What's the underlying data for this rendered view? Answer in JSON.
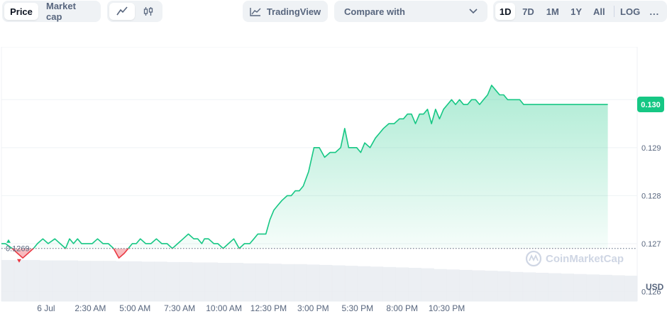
{
  "toolbar": {
    "price_tab": "Price",
    "market_cap_tab": "Market cap",
    "line_icon": "line-chart-icon",
    "candle_icon": "candlestick-icon",
    "tradingview_label": "TradingView",
    "compare_label": "Compare with",
    "ranges": [
      "1D",
      "7D",
      "1M",
      "1Y",
      "All",
      "LOG"
    ],
    "active_range": "1D",
    "more_label": "..."
  },
  "watermark": "CoinMarketCap",
  "colors": {
    "up": "#16c784",
    "down": "#ea3943",
    "baseline": "#58667e"
  },
  "chart_data": {
    "type": "area",
    "currency_label": "USD",
    "baseline_value": 0.1269,
    "baseline_label": "0.1269",
    "current_value_label": "0.130",
    "ylim": [
      0.1258,
      0.1311
    ],
    "yticks": [
      0.126,
      0.127,
      0.128,
      0.129,
      0.13
    ],
    "ytick_labels": [
      "0.126",
      "0.127",
      "0.128",
      "0.129",
      "0.130"
    ],
    "x_range": [
      0,
      23.8
    ],
    "xticks": [
      1.67,
      3.33,
      5.0,
      6.67,
      8.33,
      10.0,
      11.67,
      13.33,
      15.0,
      16.67,
      18.33,
      20.0
    ],
    "xtick_labels": [
      "6 Jul",
      "2:30 AM",
      "5:00 AM",
      "7:30 AM",
      "10:00 AM",
      "12:30 PM",
      "3:00 PM",
      "5:30 PM",
      "8:00 PM",
      "10:30 PM"
    ],
    "series": [
      {
        "x": [
          0,
          0.15,
          0.4,
          0.6,
          0.8,
          1.0,
          1.2,
          1.35,
          1.55,
          1.75,
          2.0,
          2.2,
          2.4,
          2.55,
          2.7,
          2.85,
          3.0,
          3.2,
          3.4,
          3.6,
          3.8,
          4.0,
          4.2,
          4.4,
          4.6,
          4.75,
          4.9,
          5.05,
          5.2,
          5.4,
          5.6,
          5.8,
          6.0,
          6.2,
          6.4,
          6.6,
          6.8,
          7.0,
          7.2,
          7.35,
          7.5,
          7.6,
          7.75,
          7.95,
          8.1,
          8.3,
          8.5,
          8.7,
          8.9,
          9.1,
          9.3,
          9.45,
          9.6,
          9.75,
          9.9,
          10.05,
          10.2,
          10.35,
          10.5,
          10.7,
          10.85,
          11.0,
          11.15,
          11.3,
          11.5,
          11.7,
          11.9,
          12.1,
          12.3,
          12.5,
          12.7,
          12.85,
          13.0,
          13.15,
          13.3,
          13.45,
          13.6,
          13.8,
          14.0,
          14.15,
          14.3,
          14.5,
          14.7,
          14.9,
          15.05,
          15.2,
          15.35,
          15.5,
          15.65,
          15.8,
          15.95,
          16.1,
          16.25,
          16.4,
          16.55,
          16.7,
          16.85,
          17.0,
          17.15,
          17.3,
          17.45,
          17.6,
          17.75,
          17.9,
          18.05,
          18.2,
          18.35,
          18.5,
          18.65,
          18.8,
          18.95,
          19.1,
          19.25,
          19.4,
          19.55,
          19.7,
          19.85,
          20.0,
          20.15,
          20.3,
          20.45,
          20.6,
          20.75,
          20.9,
          21.05,
          21.2,
          21.35,
          21.5,
          21.65,
          21.8,
          21.95,
          22.1,
          22.25,
          22.4,
          22.55,
          22.7
        ],
        "values": [
          0.127,
          0.127,
          0.1269,
          0.1268,
          0.1267,
          0.1268,
          0.1269,
          0.127,
          0.1271,
          0.127,
          0.1271,
          0.127,
          0.1269,
          0.1271,
          0.127,
          0.1271,
          0.127,
          0.127,
          0.127,
          0.1271,
          0.127,
          0.127,
          0.1269,
          0.1267,
          0.1268,
          0.1269,
          0.127,
          0.127,
          0.1271,
          0.127,
          0.127,
          0.1271,
          0.127,
          0.127,
          0.1269,
          0.127,
          0.1271,
          0.1272,
          0.1271,
          0.1271,
          0.127,
          0.1271,
          0.1271,
          0.127,
          0.127,
          0.1269,
          0.127,
          0.1271,
          0.1269,
          0.127,
          0.127,
          0.1271,
          0.1272,
          0.1272,
          0.1272,
          0.1275,
          0.1277,
          0.1278,
          0.1279,
          0.128,
          0.128,
          0.1281,
          0.1281,
          0.1282,
          0.1285,
          0.129,
          0.129,
          0.1288,
          0.1289,
          0.1289,
          0.129,
          0.1294,
          0.129,
          0.129,
          0.129,
          0.1289,
          0.1291,
          0.129,
          0.1292,
          0.1293,
          0.1294,
          0.1295,
          0.1295,
          0.1296,
          0.1296,
          0.1297,
          0.1297,
          0.1295,
          0.1297,
          0.1297,
          0.1298,
          0.1295,
          0.1298,
          0.1296,
          0.1298,
          0.1299,
          0.13,
          0.1299,
          0.13,
          0.1299,
          0.1299,
          0.13,
          0.13,
          0.1299,
          0.13,
          0.1301,
          0.1303,
          0.1302,
          0.1301,
          0.1301,
          0.13,
          0.13,
          0.13,
          0.13,
          0.1299,
          0.1299,
          0.1299,
          0.1299,
          0.1299,
          0.1299,
          0.1299,
          0.1299,
          0.1299,
          0.1299,
          0.1299,
          0.1299,
          0.1299,
          0.1299,
          0.1299,
          0.1299,
          0.1299,
          0.1299,
          0.1299,
          0.1299,
          0.1299,
          0.1299
        ]
      }
    ],
    "volume": [
      1.0,
      1.0,
      1.0,
      0.99,
      0.99,
      0.99,
      0.98,
      0.98,
      0.98,
      0.97,
      0.97,
      0.96,
      0.96,
      0.95,
      0.95,
      0.94,
      0.94,
      0.93,
      0.93,
      0.92,
      0.92,
      0.91,
      0.9,
      0.9,
      0.89,
      0.88,
      0.87,
      0.86,
      0.85,
      0.84,
      0.83,
      0.82,
      0.81,
      0.8,
      0.78,
      0.77,
      0.76,
      0.75,
      0.74,
      0.73,
      0.71,
      0.7,
      0.69,
      0.68,
      0.67,
      0.66,
      0.65,
      0.64,
      0.63,
      0.62
    ]
  }
}
